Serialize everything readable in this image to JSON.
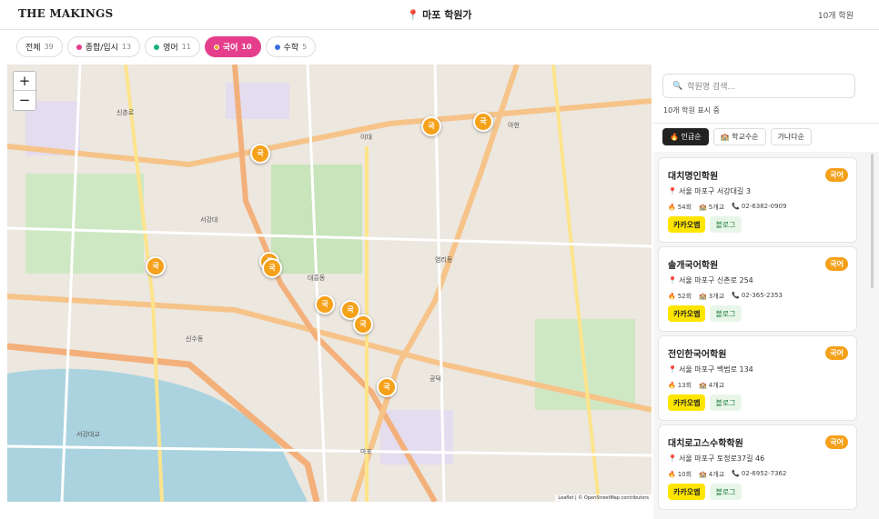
{
  "header": {
    "brand": "THE MAKINGS",
    "location_pin": "📍",
    "location": "마포 학원가",
    "count": "10개 학원"
  },
  "filters": [
    {
      "label": "전체",
      "count": "39",
      "dot": "",
      "active": false
    },
    {
      "label": "종합/입시",
      "count": "13",
      "dot": "#e53e8c",
      "active": false
    },
    {
      "label": "영어",
      "count": "11",
      "dot": "#1bb07a",
      "active": false
    },
    {
      "label": "국어",
      "count": "10",
      "dot": "#f5a11a",
      "active": true
    },
    {
      "label": "수학",
      "count": "5",
      "dot": "#3b6fe0",
      "active": false
    }
  ],
  "map": {
    "zoom_in": "+",
    "zoom_out": "−",
    "marker_label": "국",
    "marker_color": "#f5a11a",
    "attribution": "Leaflet | © OpenStreetMap contributors",
    "labels": [
      "신촌로",
      "서강대교",
      "마포",
      "서강대",
      "이대",
      "아현",
      "공덕",
      "신수동",
      "대흥동",
      "염리동"
    ]
  },
  "panel": {
    "search_placeholder": "학원명 검색...",
    "showing": "10개 학원 표시 중",
    "sorts": [
      {
        "label": "🔥 인급순",
        "active": true
      },
      {
        "label": "🏫 학교수순",
        "active": false
      },
      {
        "label": "가나다순",
        "active": false
      }
    ],
    "kakao_label": "카카오맵",
    "blog_label": "블로그",
    "academies": [
      {
        "name": "대치명인학원",
        "badge": "국어",
        "address": "서울 마포구 서강대길 3",
        "popularity": "54회",
        "schools": "5개교",
        "phone": "02-6382-0909"
      },
      {
        "name": "솔개국어학원",
        "badge": "국어",
        "address": "서울 마포구 신촌로 254",
        "popularity": "52회",
        "schools": "3개교",
        "phone": "02-365-2353"
      },
      {
        "name": "전인한국어학원",
        "badge": "국어",
        "address": "서울 마포구 백범로 134",
        "popularity": "13회",
        "schools": "4개교",
        "phone": ""
      },
      {
        "name": "대치로고스수학학원",
        "badge": "국어",
        "address": "서울 마포구 토정로37길 46",
        "popularity": "10회",
        "schools": "4개교",
        "phone": "02-6952-7362"
      }
    ]
  }
}
